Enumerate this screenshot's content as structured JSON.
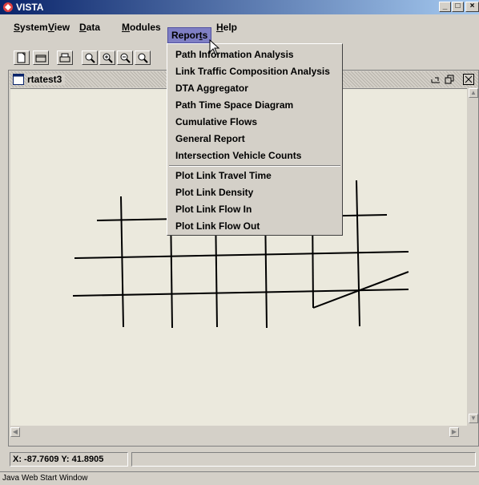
{
  "window": {
    "title": "VISTA",
    "controls": [
      "minimize",
      "maximize",
      "close"
    ]
  },
  "menubar": {
    "items": [
      {
        "label": "System",
        "mnemonic": "S"
      },
      {
        "label": "View",
        "mnemonic": "V"
      },
      {
        "label": "Data",
        "mnemonic": "D"
      },
      {
        "label": "Modules",
        "mnemonic": "M"
      },
      {
        "label": "Reports",
        "mnemonic": "t"
      },
      {
        "label": "Help",
        "mnemonic": "H"
      }
    ],
    "active": "Reports"
  },
  "toolbar": {
    "buttons": [
      "new-icon",
      "open-icon",
      "print-icon",
      "zoom-icon",
      "zoom-in-icon",
      "zoom-out-icon",
      "zoom-reset-icon"
    ]
  },
  "reports_menu": {
    "group1": [
      "Path Information Analysis",
      "Link Traffic Composition Analysis",
      "DTA Aggregator",
      "Path Time Space Diagram",
      "Cumulative Flows",
      "General Report",
      "Intersection Vehicle Counts"
    ],
    "group2": [
      "Plot Link Travel Time",
      "Plot Link Density",
      "Plot Link Flow In",
      "Plot Link Flow Out"
    ]
  },
  "internal_frame": {
    "title": "rtatest3"
  },
  "status": {
    "coordinates": "X: -87.7609 Y: 41.8905",
    "message": ""
  },
  "footer": {
    "text": "Java Web Start Window"
  },
  "colors": {
    "titlebar_start": "#0a246a",
    "titlebar_end": "#a6caf0",
    "menu_highlight": "#7f7fc4",
    "canvas": "#ebe9dd"
  }
}
